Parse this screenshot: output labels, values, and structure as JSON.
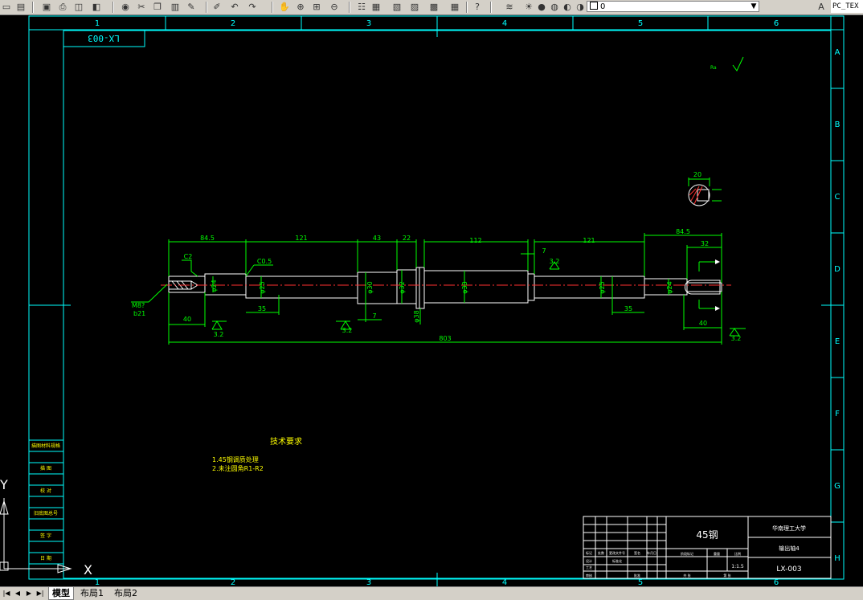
{
  "toolbar": {
    "layer_value": "0",
    "text_style_value": "PC_TEX",
    "icons": [
      "new-icon",
      "open-icon",
      "save-icon",
      "print-icon",
      "preview-icon",
      "publish-icon",
      "globe-icon",
      "cut-icon",
      "copy-icon",
      "paste-icon",
      "brush-icon",
      "matchprop-icon",
      "undo-icon",
      "redo-icon",
      "pan-icon",
      "zoom-realtime-icon",
      "zoom-window-icon",
      "zoom-previous-icon",
      "properties-icon",
      "designcenter-icon",
      "toolpalette-icon",
      "sheetset-icon",
      "markup-icon",
      "calculator-icon",
      "help-icon",
      "layer-manager-icon",
      "layer-on-icon",
      "layer-freeze-icon",
      "layer-lock-icon",
      "layer-previous-icon",
      "layer-state-icon",
      "text-style-icon"
    ]
  },
  "frame": {
    "col_labels": [
      "1",
      "2",
      "3",
      "4",
      "5",
      "6"
    ],
    "row_labels": [
      "A",
      "B",
      "C",
      "D",
      "E",
      "F",
      "G",
      "H"
    ]
  },
  "drawing": {
    "code_box": "LX-003",
    "roughness_corner": "Ra",
    "dims": {
      "d84_5_left": "84.5",
      "d121_left": "121",
      "d43": "43",
      "d22": "22",
      "d112": "112",
      "d121_right": "121",
      "d84_5_right": "84.5",
      "d32": "32",
      "d7_top": "7",
      "d35_left": "35",
      "d35_right": "35",
      "d7_bottom": "7",
      "d40_left": "40",
      "d40_right": "40",
      "d803": "803",
      "c2": "C2",
      "c05": "C0.5",
      "m87": "M8?",
      "b21": "b21",
      "d20": "20",
      "phi24_left": "φ24",
      "phi25_left": "φ25",
      "phi30": "φ30",
      "phi32": "φ32",
      "phi38": "φ38",
      "phi33": "φ33",
      "phi25_right": "φ25",
      "phi24_right": "φ24",
      "r32_left": "3.2",
      "r32_mid": "3.2",
      "r32_right": "3.2",
      "r32_top": "3.2"
    },
    "notes_title": "技术要求",
    "notes": [
      "1.45钢调质处理",
      "2.未注圆角R1-R2"
    ]
  },
  "side_table": [
    "描图材料规格",
    "描 图",
    "校 对",
    "旧底图总号",
    "签 字",
    "日 期"
  ],
  "title_block": {
    "material": "45钢",
    "school": "华南理工大学",
    "part_name": "输出轴4",
    "code": "LX-003",
    "scale": "1:1.5",
    "small_labels": [
      "标记",
      "处数",
      "更改文件号",
      "签名",
      "年月日",
      "设计",
      "标准化",
      "审核",
      "工艺",
      "批准",
      "阶段标记",
      "重量",
      "比例",
      "共 张",
      "第 张"
    ]
  },
  "ucs": {
    "x_label": "X",
    "y_label": "Y"
  },
  "tabs": {
    "model": "模型",
    "layout1": "布局1",
    "layout2": "布局2"
  },
  "colors": {
    "frame": "#00ffff",
    "object": "#ffffff",
    "dims": "#00ff00",
    "center": "#ff3030",
    "notes": "#ffff00",
    "bg": "#000000"
  }
}
